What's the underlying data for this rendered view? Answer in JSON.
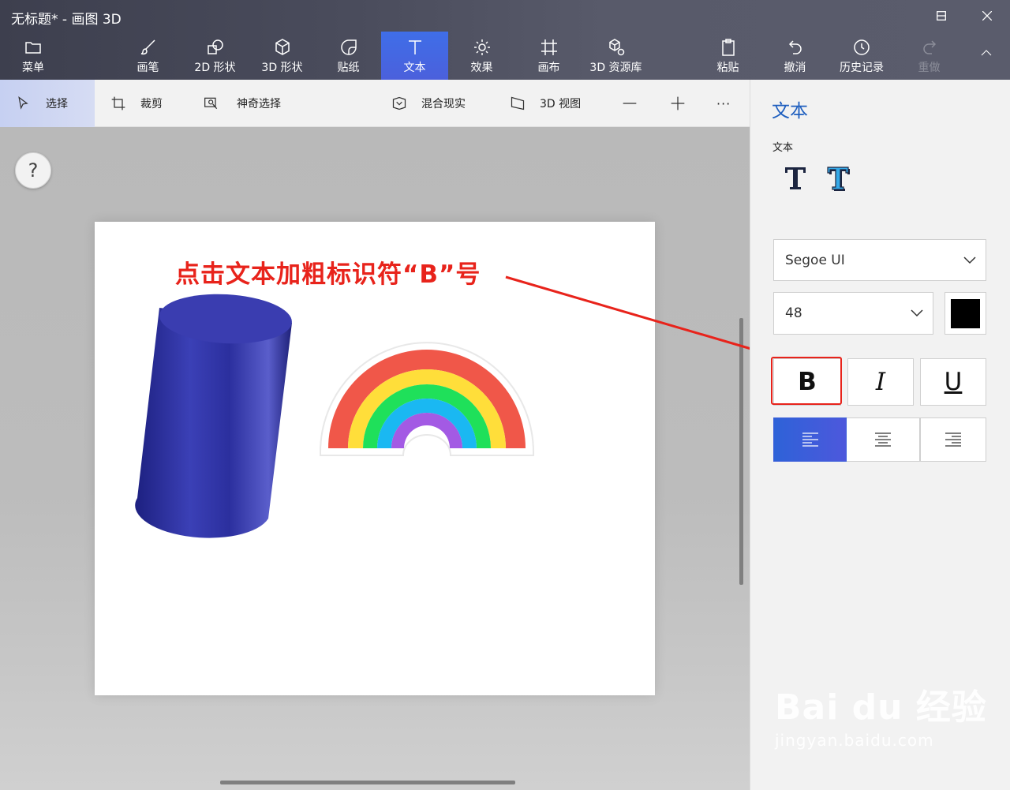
{
  "window": {
    "title": "无标题* - 画图 3D",
    "minimize": "minimize",
    "maximize": "maximize",
    "close": "close"
  },
  "ribbon": {
    "menu": "菜单",
    "items": [
      "画笔",
      "2D 形状",
      "3D 形状",
      "贴纸",
      "文本",
      "效果",
      "画布",
      "3D 资源库"
    ],
    "active": "文本",
    "paste": "粘贴",
    "undo": "撤消",
    "history": "历史记录",
    "redo": "重做"
  },
  "toolbar": {
    "select": "选择",
    "crop": "裁剪",
    "magic_select": "神奇选择",
    "mixed_reality": "混合现实",
    "view_3d": "3D 视图",
    "more": "···"
  },
  "canvas": {
    "help": "?",
    "annotation": "点击文本加粗标识符“B”号",
    "objects": [
      "cylinder-3d",
      "rainbow-sticker"
    ]
  },
  "text_panel": {
    "title": "文本",
    "text_type_label": "文本",
    "font": "Segoe UI",
    "size": "48",
    "text_color": "#000000",
    "bold": "B",
    "italic": "I",
    "underline": "U",
    "alignment": [
      "left",
      "center",
      "right"
    ],
    "alignment_selected": "left"
  },
  "watermark": {
    "brand": "Bai du 经验",
    "url": "jingyan.baidu.com"
  },
  "colors": {
    "accent": "#3f6ee8",
    "annotation_red": "#e8231b",
    "cylinder": "#2b2f9a"
  }
}
